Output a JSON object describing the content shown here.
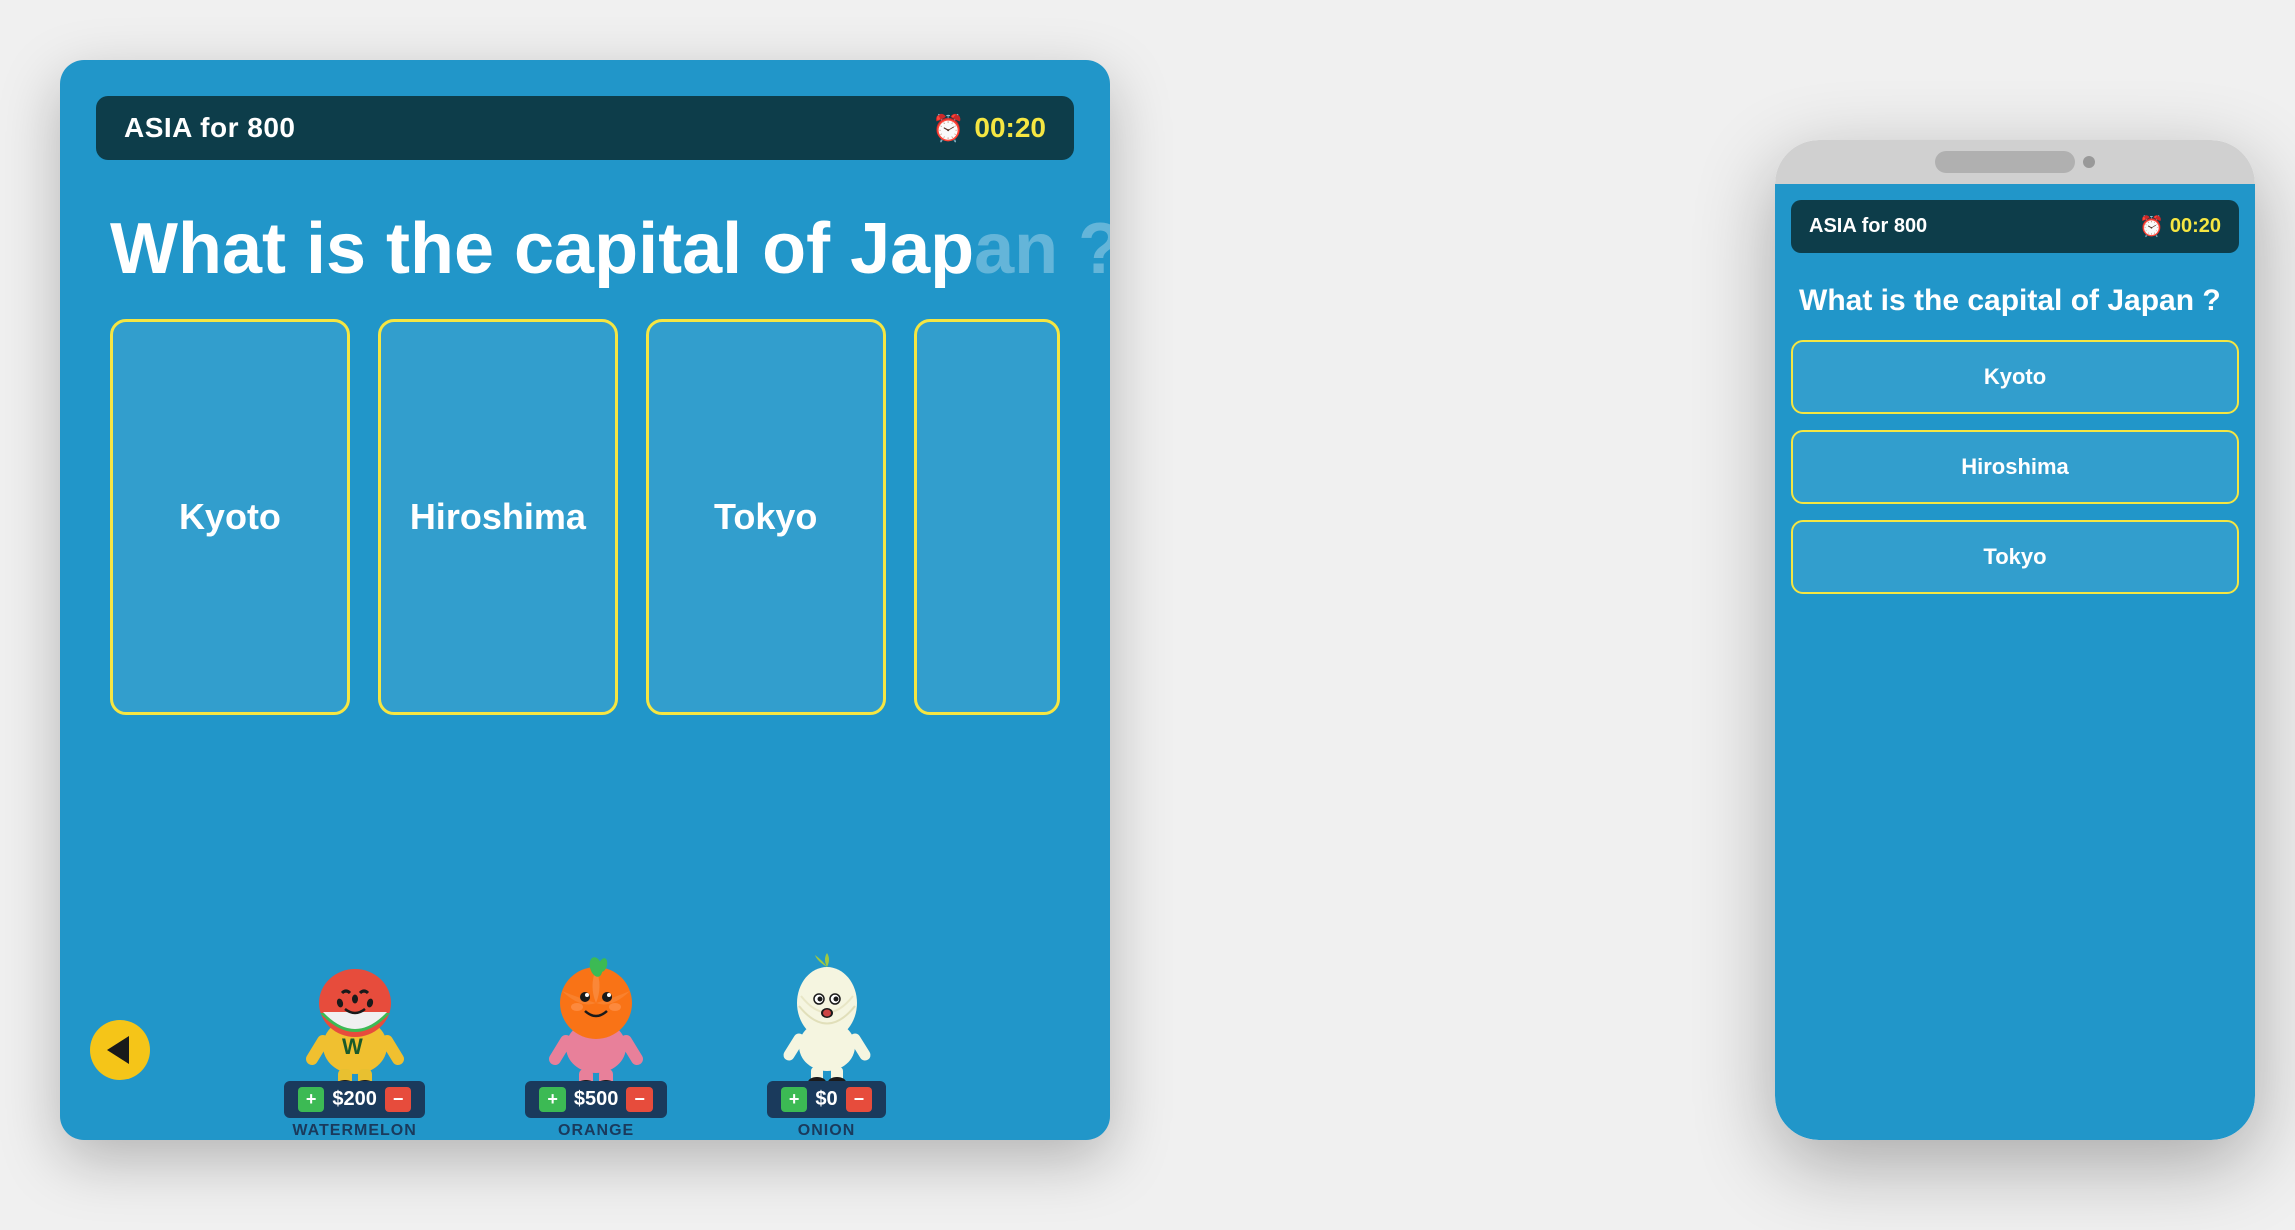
{
  "desktop": {
    "category": "ASIA for 800",
    "timer": "00:20",
    "question": "What is the capital of Jap",
    "answers": [
      "Kyoto",
      "Hiroshima",
      "Tokyo"
    ],
    "characters": [
      {
        "name": "WATERMELON",
        "score": "$200",
        "emoji": "🍉"
      },
      {
        "name": "ORANGE",
        "score": "$500",
        "emoji": "🍊"
      },
      {
        "name": "ONION",
        "score": "$0",
        "emoji": "🧅"
      }
    ]
  },
  "mobile": {
    "category": "ASIA for 800",
    "timer": "00:20",
    "question": "What is the capital of Japan ?",
    "answers": [
      "Kyoto",
      "Hiroshima",
      "Tokyo"
    ]
  },
  "icons": {
    "timer": "⏰",
    "back_arrow": "◀"
  },
  "colors": {
    "background": "#2196c9",
    "header_bg": "#0d3d4a",
    "yellow_border": "#f5e642",
    "score_bar_bg": "#1a3a5c",
    "plus_bg": "#3cba54",
    "minus_bg": "#e74c3c"
  }
}
